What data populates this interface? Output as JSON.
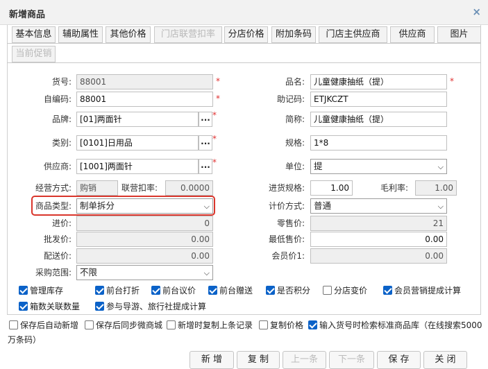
{
  "dialog": {
    "title": "新增商品",
    "close_icon": "×"
  },
  "tabs": [
    {
      "label": "基本信息",
      "state": "active"
    },
    {
      "label": "辅助属性",
      "state": "normal"
    },
    {
      "label": "其他价格",
      "state": "normal"
    },
    {
      "label": "门店联营扣率",
      "state": "disabled"
    },
    {
      "label": "分店价格",
      "state": "normal"
    },
    {
      "label": "附加条码",
      "state": "normal"
    },
    {
      "label": "门店主供应商",
      "state": "normal"
    },
    {
      "label": "供应商",
      "state": "normal"
    },
    {
      "label": "图片",
      "state": "normal"
    },
    {
      "label": "当前促销",
      "state": "disabled"
    }
  ],
  "form": {
    "huohao": {
      "label": "货号:",
      "value": "88001"
    },
    "zibianma": {
      "label": "自编码:",
      "value": "88001"
    },
    "pinpai": {
      "label": "品牌:",
      "value": "[01]两面针"
    },
    "leibie": {
      "label": "类别:",
      "value": "[0101]日用品"
    },
    "gongyingshang": {
      "label": "供应商:",
      "value": "[1001]两面针"
    },
    "jingying": {
      "label": "经营方式:",
      "value": "购销"
    },
    "lianying": {
      "label": "联营扣率:",
      "value": "0.0000"
    },
    "leixing": {
      "label": "商品类型:",
      "value": "制单拆分"
    },
    "jinjia": {
      "label": "进价:",
      "value": "0"
    },
    "pifa": {
      "label": "批发价:",
      "value": "0.00"
    },
    "peisong": {
      "label": "配送价:",
      "value": "0.00"
    },
    "caigou": {
      "label": "采购范围:",
      "value": "不限"
    },
    "pinming": {
      "label": "品名:",
      "value": "儿童健康抽纸（提）"
    },
    "zhuji": {
      "label": "助记码:",
      "value": "ETJKCZT"
    },
    "jiancheng": {
      "label": "简称:",
      "value": "儿童健康抽纸（提）"
    },
    "guige": {
      "label": "规格:",
      "value": "1*8"
    },
    "danwei": {
      "label": "单位:",
      "value": "提"
    },
    "jinhuo": {
      "label": "进货规格:",
      "value": "1.00"
    },
    "maoli": {
      "label": "毛利率:",
      "value": "1.00"
    },
    "jijia": {
      "label": "计价方式:",
      "value": "普通"
    },
    "lingshou": {
      "label": "零售价:",
      "value": "21"
    },
    "zuidi": {
      "label": "最低售价:",
      "value": "0.00"
    },
    "huiyuan": {
      "label": "会员价1:",
      "value": "0.00"
    },
    "required_mark": "*",
    "ellipsis": "..."
  },
  "checks": [
    {
      "label": "管理库存",
      "checked": true
    },
    {
      "label": "前台打折",
      "checked": true
    },
    {
      "label": "前台议价",
      "checked": true
    },
    {
      "label": "前台赠送",
      "checked": true
    },
    {
      "label": "是否积分",
      "checked": true
    },
    {
      "label": "分店变价",
      "checked": false
    },
    {
      "label": "会员营销提成计算",
      "checked": true
    },
    {
      "label": "箱数关联数量",
      "checked": true
    },
    {
      "label": "参与导游、旅行社提成计算",
      "checked": true
    }
  ],
  "options": [
    {
      "label": "保存后自动新增",
      "checked": false
    },
    {
      "label": "保存后同步微商城",
      "checked": false
    },
    {
      "label": "新增时复制上条记录",
      "checked": false
    },
    {
      "label": "复制价格",
      "checked": false
    },
    {
      "label": "输入货号时检索标准商品库（在线搜索5000",
      "checked": true
    }
  ],
  "options_wrap": "万条码）",
  "buttons": [
    {
      "label": "新 增",
      "enabled": true
    },
    {
      "label": "复 制",
      "enabled": true
    },
    {
      "label": "上一条",
      "enabled": false
    },
    {
      "label": "下一条",
      "enabled": false
    },
    {
      "label": "保 存",
      "enabled": true
    },
    {
      "label": "关 闭",
      "enabled": true
    }
  ],
  "colors": {
    "accent": "#0b62c8",
    "highlight": "#d9352b",
    "required": "#e03030"
  },
  "icons": {
    "close": "close-icon",
    "dropdown": "chevron-down-icon",
    "ellipsis": "ellipsis-icon",
    "checkbox": "checkbox-icon"
  }
}
